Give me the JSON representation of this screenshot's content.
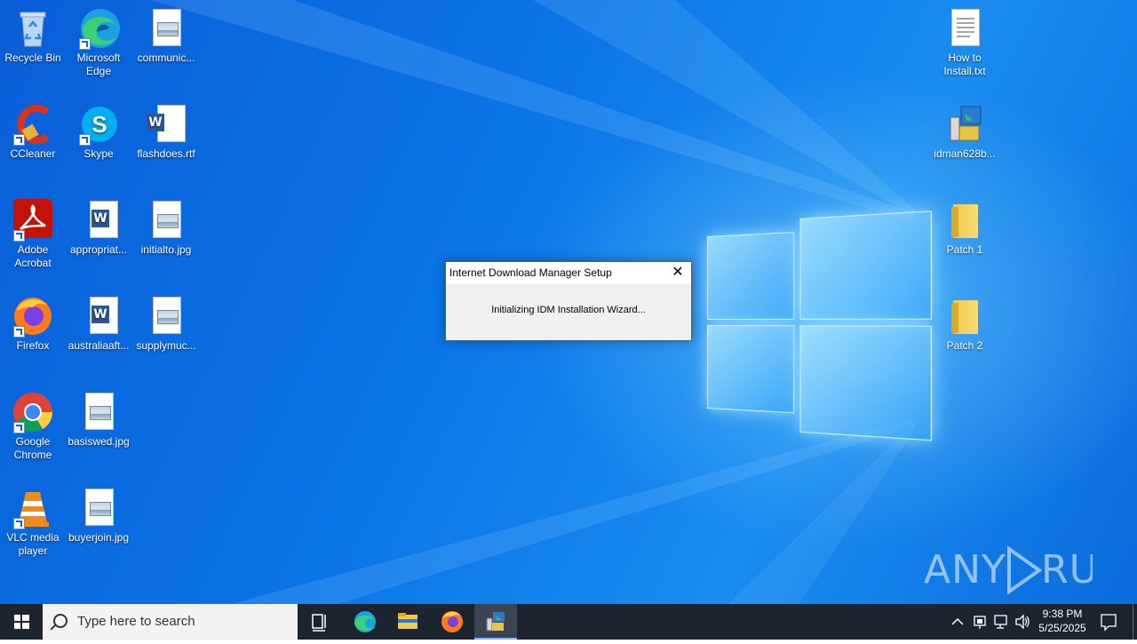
{
  "desktop": {
    "icons_left": [
      {
        "label": "Recycle Bin",
        "icon": "recycle-bin-icon"
      },
      {
        "label": "Microsoft Edge",
        "icon": "edge-icon"
      },
      {
        "label": "communic...",
        "icon": "image-file-icon"
      },
      {
        "label": "CCleaner",
        "icon": "ccleaner-icon"
      },
      {
        "label": "Skype",
        "icon": "skype-icon"
      },
      {
        "label": "flashdoes.rtf",
        "icon": "word-doc-icon"
      },
      {
        "label": "Adobe Acrobat",
        "icon": "acrobat-icon"
      },
      {
        "label": "appropriat...",
        "icon": "word-doc-icon"
      },
      {
        "label": "initialto.jpg",
        "icon": "image-file-icon"
      },
      {
        "label": "Firefox",
        "icon": "firefox-icon"
      },
      {
        "label": "australiaaft...",
        "icon": "word-doc-icon"
      },
      {
        "label": "supplymuc...",
        "icon": "image-file-icon"
      },
      {
        "label": "Google Chrome",
        "icon": "chrome-icon"
      },
      {
        "label": "basiswed.jpg",
        "icon": "image-file-icon"
      },
      {
        "label": "VLC media player",
        "icon": "vlc-icon"
      },
      {
        "label": "buyerjoin.jpg",
        "icon": "image-file-icon"
      }
    ],
    "icons_right": [
      {
        "label": "How to Install.txt",
        "icon": "text-file-icon"
      },
      {
        "label": "idman628b...",
        "icon": "installer-icon"
      },
      {
        "label": "Patch 1",
        "icon": "folder-icon"
      },
      {
        "label": "Patch 2",
        "icon": "folder-icon"
      }
    ],
    "watermark": "ANY RUN"
  },
  "dialog": {
    "title": "Internet Download Manager Setup",
    "close_glyph": "✕",
    "message": "Initializing IDM Installation Wizard..."
  },
  "taskbar": {
    "search_placeholder": "Type here to search",
    "pinned": [
      "task-view-icon",
      "edge-icon",
      "file-explorer-icon",
      "firefox-icon",
      "idm-setup-icon"
    ],
    "clock_time": "9:38 PM",
    "clock_date": "5/25/2025"
  }
}
